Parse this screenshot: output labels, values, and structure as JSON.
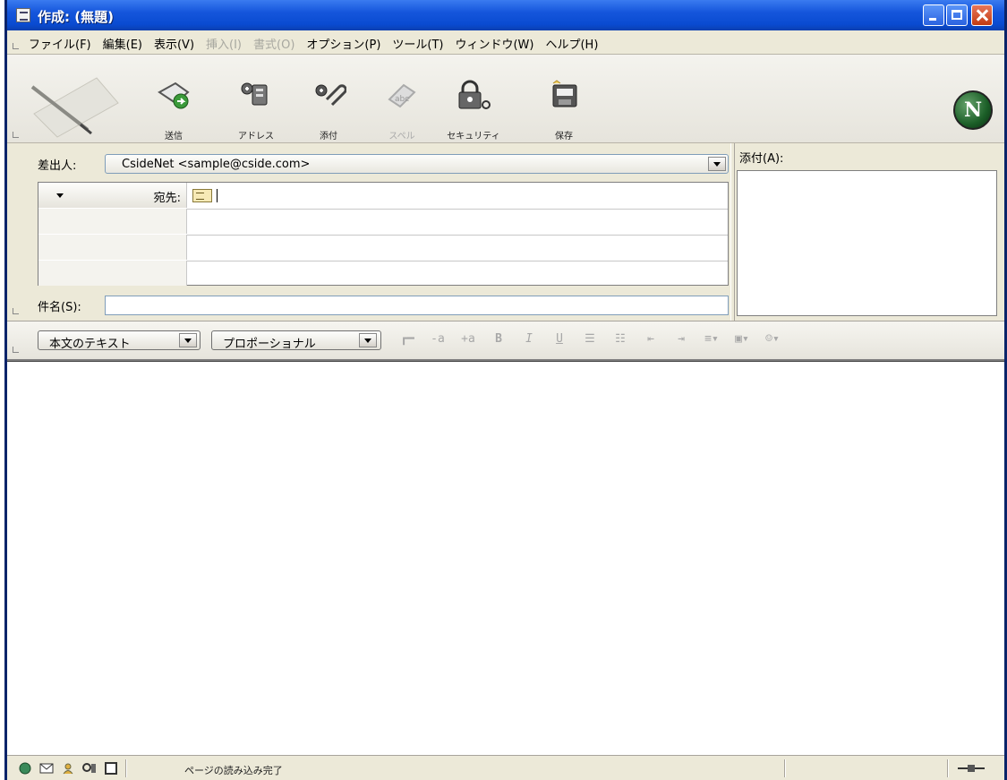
{
  "window": {
    "title": "作成: (無題)"
  },
  "menu": [
    {
      "label": "ファイル(F)",
      "enabled": true
    },
    {
      "label": "編集(E)",
      "enabled": true
    },
    {
      "label": "表示(V)",
      "enabled": true
    },
    {
      "label": "挿入(I)",
      "enabled": false
    },
    {
      "label": "書式(O)",
      "enabled": false
    },
    {
      "label": "オプション(P)",
      "enabled": true
    },
    {
      "label": "ツール(T)",
      "enabled": true
    },
    {
      "label": "ウィンドウ(W)",
      "enabled": true
    },
    {
      "label": "ヘルプ(H)",
      "enabled": true
    }
  ],
  "toolbar": {
    "send": {
      "label": "送信",
      "icon": "send-icon"
    },
    "address": {
      "label": "アドレス",
      "icon": "address-book-icon"
    },
    "attach": {
      "label": "添付",
      "icon": "paperclip-icon"
    },
    "spell": {
      "label": "スペル",
      "icon": "spellcheck-icon"
    },
    "security": {
      "label": "セキュリティ",
      "icon": "lock-icon"
    },
    "save": {
      "label": "保存",
      "icon": "save-icon"
    },
    "logo": "N"
  },
  "header": {
    "from_label": "差出人:",
    "from_value": "CsideNet <sample@cside.com>",
    "attach_label": "添付(A):",
    "recipients": [
      {
        "type": "宛先:",
        "value": ""
      },
      {
        "type": "",
        "value": ""
      },
      {
        "type": "",
        "value": ""
      },
      {
        "type": "",
        "value": ""
      }
    ],
    "subject_label": "件名(S):",
    "subject_value": ""
  },
  "format_bar": {
    "paragraph_style": "本文のテキスト",
    "font": "プロポーショナル"
  },
  "status": {
    "text": "ページの読み込み完了"
  },
  "colors": {
    "titlebar": "#0a4bd1",
    "chrome": "#ece9d8"
  }
}
